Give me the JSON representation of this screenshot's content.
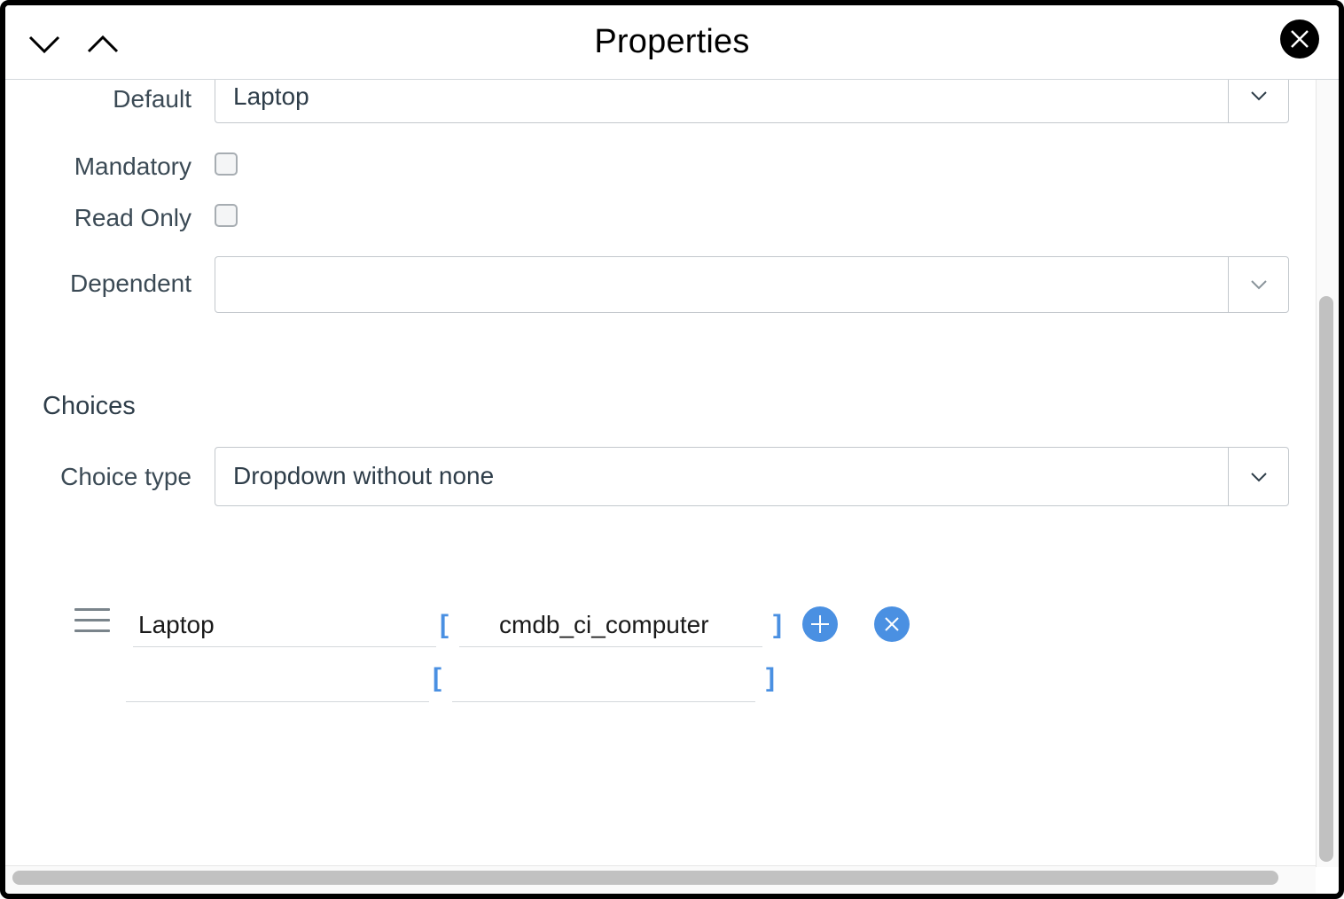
{
  "header": {
    "title": "Properties",
    "prev_icon": "chevron-down-icon",
    "next_icon": "chevron-up-icon",
    "close_icon": "close-icon"
  },
  "form": {
    "default": {
      "label": "Default",
      "value": "Laptop"
    },
    "mandatory": {
      "label": "Mandatory",
      "checked": false
    },
    "read_only": {
      "label": "Read Only",
      "checked": false
    },
    "dependent": {
      "label": "Dependent",
      "value": ""
    }
  },
  "choices": {
    "section_title": "Choices",
    "choice_type": {
      "label": "Choice type",
      "value": "Dropdown without none"
    },
    "rows": [
      {
        "label": "Laptop",
        "value": "cmdb_ci_computer",
        "open_bracket": "[",
        "close_bracket": "]"
      },
      {
        "label": "",
        "value": "",
        "open_bracket": "[",
        "close_bracket": "]"
      }
    ]
  },
  "colors": {
    "accent": "#4a90e2",
    "border": "#c3c8cd",
    "text": "#2e3d49"
  }
}
